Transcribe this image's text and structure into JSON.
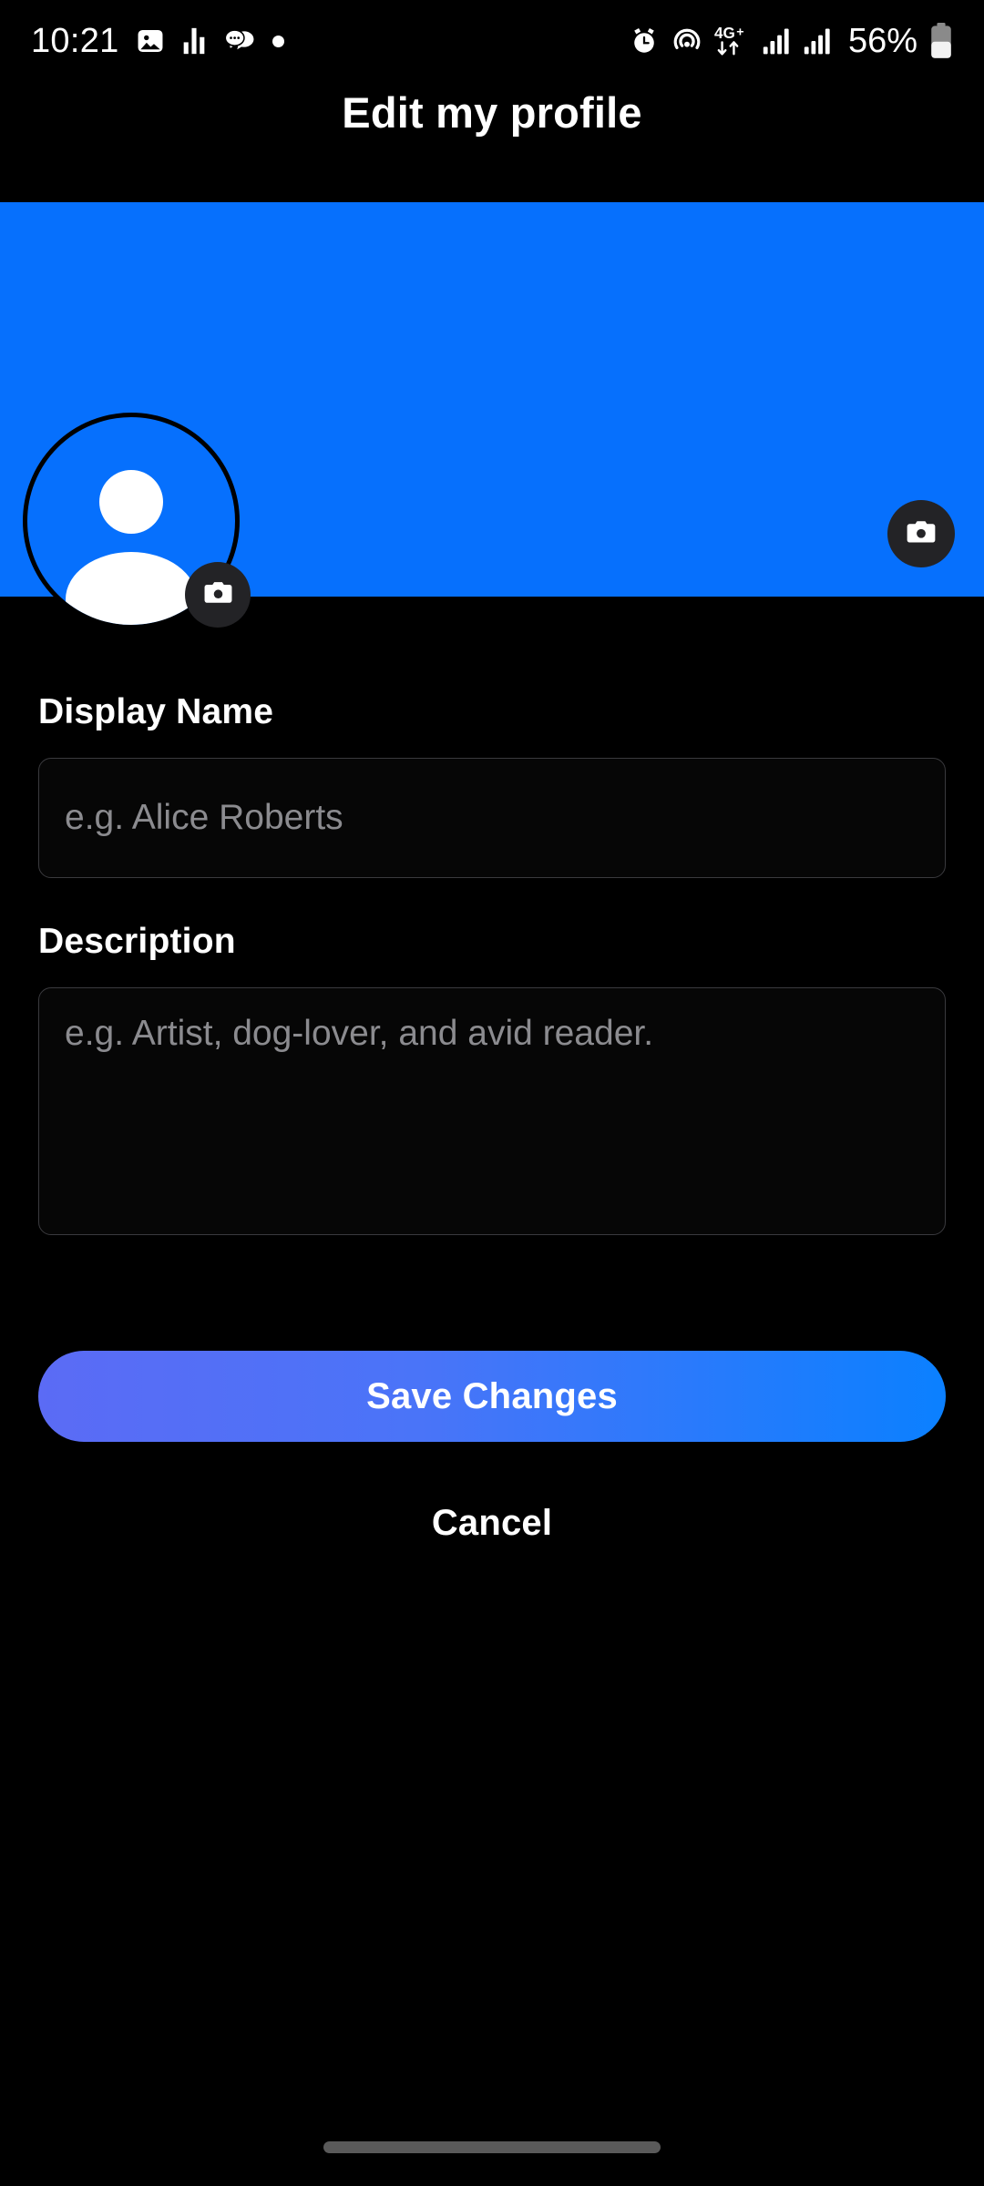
{
  "status_bar": {
    "time": "10:21",
    "battery_percent": "56%",
    "left_icons": [
      "image-icon",
      "bar-chart-icon",
      "chat-bubble-icon",
      "dot-icon"
    ],
    "right_icons": [
      "alarm-icon",
      "hotspot-icon",
      "network-4gplus-icon",
      "signal-bars-icon-1",
      "signal-bars-icon-2",
      "battery-icon"
    ],
    "network_label": "4G+"
  },
  "header": {
    "title": "Edit my profile"
  },
  "banner": {
    "color": "#0670fd",
    "change_photo_icon": "camera-icon"
  },
  "avatar": {
    "placeholder_icon": "person-icon",
    "change_photo_icon": "camera-icon",
    "color": "#0670fd"
  },
  "form": {
    "display_name": {
      "label": "Display Name",
      "value": "",
      "placeholder": "e.g. Alice Roberts"
    },
    "description": {
      "label": "Description",
      "value": "",
      "placeholder": "e.g. Artist, dog-lover, and avid reader."
    }
  },
  "actions": {
    "save_label": "Save Changes",
    "cancel_label": "Cancel",
    "save_gradient_start": "#5b6bf5",
    "save_gradient_end": "#0b80ff"
  },
  "system_nav": {
    "home_indicator": "home-indicator"
  }
}
